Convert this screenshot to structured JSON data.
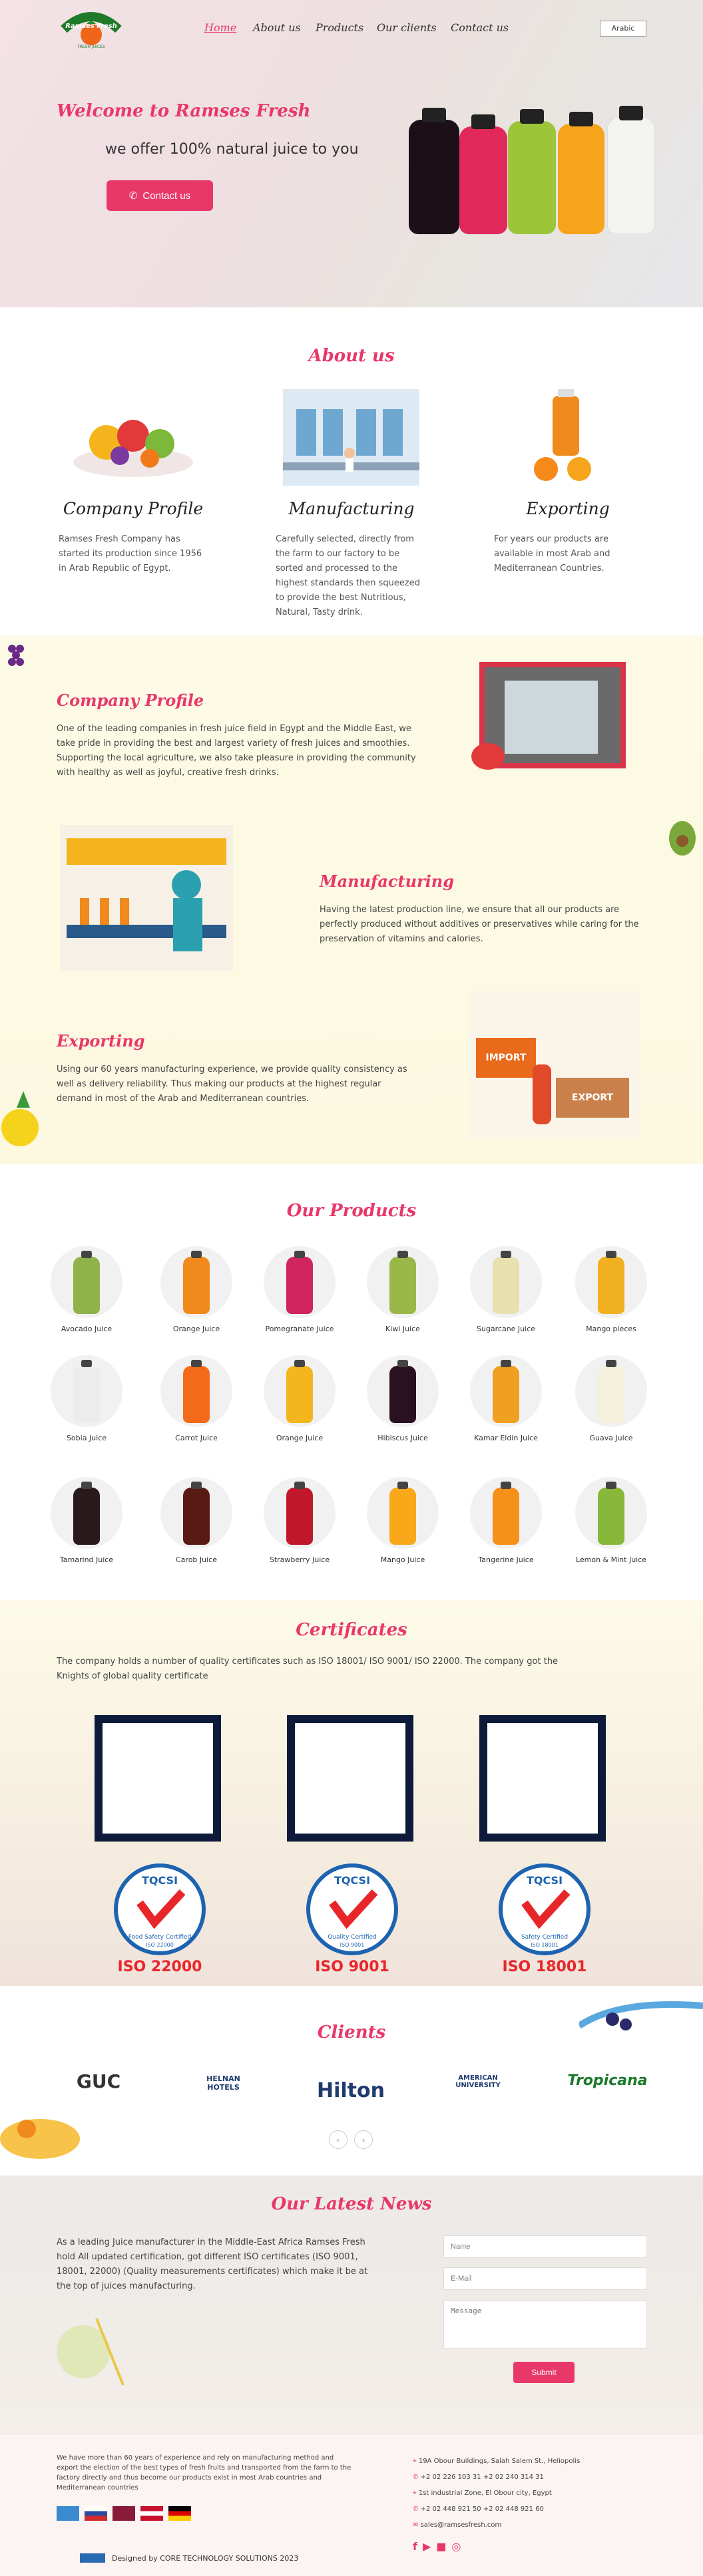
{
  "brand": {
    "logo_text": "Ramses Fresh",
    "logo_sub": "FRESH JUICES"
  },
  "nav": {
    "items": [
      "Home",
      "About us",
      "Products",
      "Our clients",
      "Contact us"
    ],
    "lang_button": "Arabic"
  },
  "hero": {
    "title": "Welcome to Ramses Fresh",
    "subtitle": "we offer 100% natural juice to you",
    "contact_button": "Contact us"
  },
  "about": {
    "title": "About us",
    "columns": [
      {
        "heading": "Company Profile",
        "text": "Ramses Fresh Company has started its production since 1956 in Arab Republic of Egypt."
      },
      {
        "heading": "Manufacturing",
        "text": "Carefully selected, directly from the farm to our factory to be sorted and processed to the highest standards then squeezed to provide the best Nutritious, Natural, Tasty drink."
      },
      {
        "heading": "Exporting",
        "text": "For years our products are available in most Arab and Mediterranean Countries."
      }
    ]
  },
  "details": {
    "profile": {
      "heading": "Company Profile",
      "text": "One of the leading companies in fresh juice field in Egypt and the Middle East, we take pride in providing the best and largest variety of fresh juices and smoothies. Supporting the local agriculture, we also take pleasure in providing the community with healthy as well as joyful, creative fresh drinks."
    },
    "manufacturing": {
      "heading": "Manufacturing",
      "text": "Having the latest production line, we ensure that all our products are perfectly produced without additives or preservatives while caring for the preservation of vitamins and calories."
    },
    "exporting": {
      "heading": "Exporting",
      "text": "Using our 60 years manufacturing experience, we provide quality consistency as well as delivery reliability. Thus making our products at the highest regular demand in most of the Arab and Mediterranean countries.",
      "import_label": "IMPORT",
      "export_label": "EXPORT"
    }
  },
  "products": {
    "title": "Our Products",
    "items": [
      {
        "name": "Avocado Juice",
        "color": "#8fb34a"
      },
      {
        "name": "Orange Juice",
        "color": "#f08a1c"
      },
      {
        "name": "Pomegranate Juice",
        "color": "#d0245e"
      },
      {
        "name": "Kiwi Juice",
        "color": "#9ab84a"
      },
      {
        "name": "Sugarcane Juice",
        "color": "#e9e0b0"
      },
      {
        "name": "Mango pieces",
        "color": "#f0b020"
      },
      {
        "name": "Sobia Juice",
        "color": "#ececec"
      },
      {
        "name": "Carrot Juice",
        "color": "#f26a1a"
      },
      {
        "name": "Orange Juice",
        "color": "#f5b51c"
      },
      {
        "name": "Hibiscus Juice",
        "color": "#2a1020"
      },
      {
        "name": "Kamar Eldin Juice",
        "color": "#f0a020"
      },
      {
        "name": "Guava Juice",
        "color": "#f4f0dc"
      },
      {
        "name": "Tamarind Juice",
        "color": "#2a1a1c"
      },
      {
        "name": "Carob Juice",
        "color": "#5a1a14"
      },
      {
        "name": "Strawberry Juice",
        "color": "#c0182a"
      },
      {
        "name": "Mango Juice",
        "color": "#f8a818"
      },
      {
        "name": "Tangerine Juice",
        "color": "#f59018"
      },
      {
        "name": "Lemon & Mint Juice",
        "color": "#88b83a"
      }
    ]
  },
  "certificates": {
    "title": "Certificates",
    "text": "The company holds a number of quality certificates such as ISO 18001/ ISO 9001/ ISO 22000. The company got the Knights of global quality certificate",
    "seals": [
      {
        "top": "TQCSI",
        "mid": "Food Safety Certified",
        "code": "ISO 22000",
        "label": "ISO 22000"
      },
      {
        "top": "TQCSI",
        "mid": "Quality Certified",
        "code": "ISO 9001",
        "label": "ISO 9001"
      },
      {
        "top": "TQCSI",
        "mid": "Safety Certified",
        "code": "ISO 18001",
        "label": "ISO 18001"
      }
    ]
  },
  "clients": {
    "title": "Clients",
    "logos": [
      "GUC",
      "HELNAN HOTELS",
      "Hilton",
      "AMERICAN UNIVERSITY",
      "Tropicana"
    ],
    "prev": "‹",
    "next": "›"
  },
  "news": {
    "title": "Our Latest News",
    "text": "As a leading Juice manufacturer in the Middle-East Africa Ramses Fresh hold All updated certification, got different ISO certificates (ISO 9001, 18001, 22000) (Quality measurements certificates) which make it be at the top of juices manufacturing.",
    "form": {
      "name_placeholder": "Name",
      "email_placeholder": "E-Mail",
      "message_placeholder": "Message",
      "submit": "Submit"
    }
  },
  "footer": {
    "about": "We have more than 60 years of experience and rely on manufacturing method and export the election of the best types of fresh fruits and transported from the farm to the factory directly and thus become our products exist in most Arab countries and Mediterranean countries",
    "contacts": [
      "19A Obour Buildings, Salah Salem St., Heliopolis",
      "+2 02 226 103 31  +2 02 240 314 31",
      "1st industrial Zone, El Obour city, Egypt",
      "+2 02 448 921 50  +2 02 448 921 60",
      "sales@ramsesfresh.com"
    ],
    "credit": "Designed by CORE TECHNOLOGY SOLUTIONS 2023"
  }
}
